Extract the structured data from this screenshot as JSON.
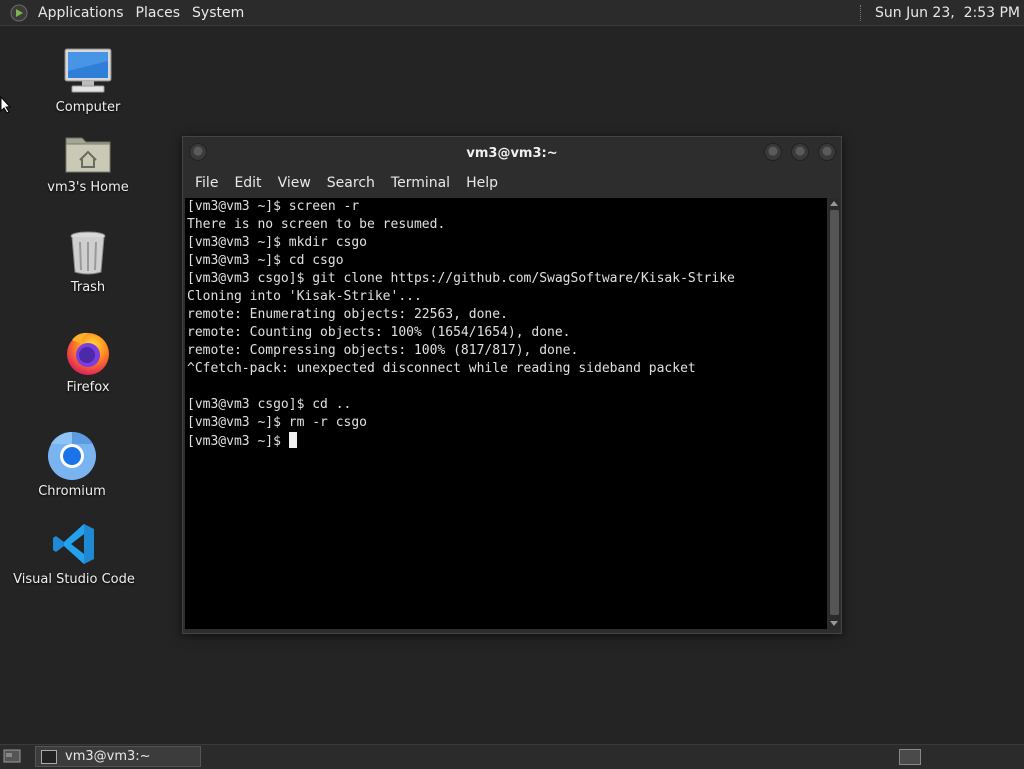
{
  "top_panel": {
    "menus": [
      "Applications",
      "Places",
      "System"
    ],
    "clock": "Sun Jun 23,  2:53 PM"
  },
  "desktop": {
    "icons": [
      {
        "label": "Computer",
        "icon": "computer-icon"
      },
      {
        "label": "vm3's Home",
        "icon": "home-folder-icon"
      },
      {
        "label": "Trash",
        "icon": "trash-icon"
      },
      {
        "label": "Firefox",
        "icon": "firefox-icon"
      },
      {
        "label": "Chromium",
        "icon": "chromium-icon"
      },
      {
        "label": "Visual Studio Code",
        "icon": "vscode-icon"
      }
    ]
  },
  "terminal": {
    "title": "vm3@vm3:~",
    "menu": [
      "File",
      "Edit",
      "View",
      "Search",
      "Terminal",
      "Help"
    ],
    "lines": [
      "[vm3@vm3 ~]$ screen -r",
      "There is no screen to be resumed.",
      "[vm3@vm3 ~]$ mkdir csgo",
      "[vm3@vm3 ~]$ cd csgo",
      "[vm3@vm3 csgo]$ git clone https://github.com/SwagSoftware/Kisak-Strike",
      "Cloning into 'Kisak-Strike'...",
      "remote: Enumerating objects: 22563, done.",
      "remote: Counting objects: 100% (1654/1654), done.",
      "remote: Compressing objects: 100% (817/817), done.",
      "^Cfetch-pack: unexpected disconnect while reading sideband packet",
      "",
      "[vm3@vm3 csgo]$ cd ..",
      "[vm3@vm3 ~]$ rm -r csgo"
    ],
    "prompt": "[vm3@vm3 ~]$ "
  },
  "bottom_panel": {
    "task_label": "vm3@vm3:~"
  }
}
